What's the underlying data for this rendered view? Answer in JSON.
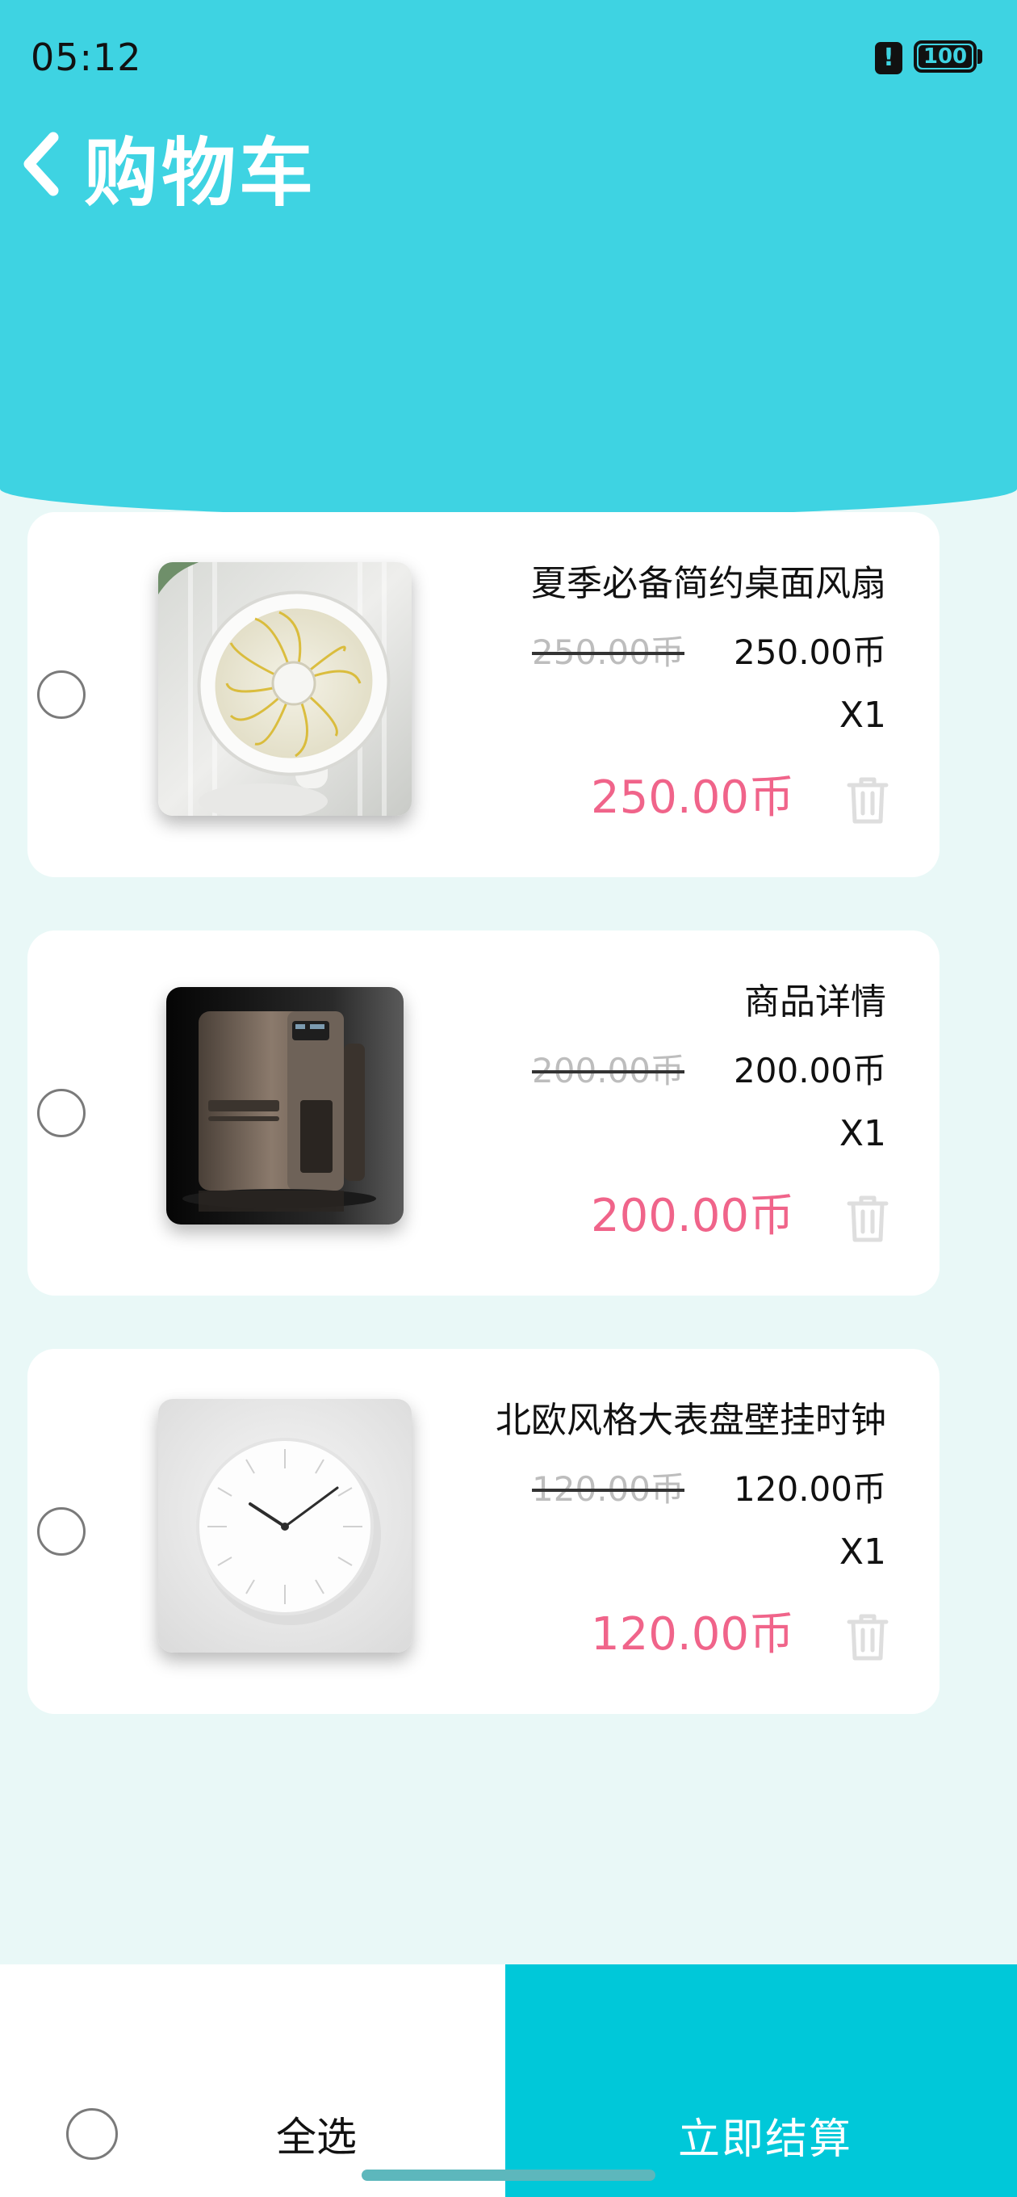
{
  "status_bar": {
    "time": "05:12",
    "alert_icon": "!",
    "battery": "100"
  },
  "header": {
    "title": "购物车",
    "back_icon": "chevron-left-icon"
  },
  "colors": {
    "header_bg": "#3ed3e2",
    "page_bg": "#e9f8f7",
    "price_accent": "#f0648a",
    "checkout_bg": "#00c8d9"
  },
  "cart": {
    "items": [
      {
        "name": "夏季必备简约桌面风扇",
        "original_price": "250.00币",
        "price": "250.00币",
        "quantity": "X1",
        "subtotal": "250.00币",
        "selected": false
      },
      {
        "name": "商品详情",
        "original_price": "200.00币",
        "price": "200.00币",
        "quantity": "X1",
        "subtotal": "200.00币",
        "selected": false
      },
      {
        "name": "北欧风格大表盘壁挂时钟",
        "original_price": "120.00币",
        "price": "120.00币",
        "quantity": "X1",
        "subtotal": "120.00币",
        "selected": false
      }
    ]
  },
  "footer": {
    "select_all_label": "全选",
    "checkout_label": "立即结算"
  }
}
